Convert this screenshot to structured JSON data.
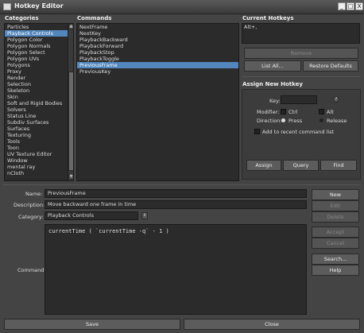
{
  "window": {
    "title": "Hotkey Editor",
    "controls": [
      "_",
      "□",
      "X"
    ]
  },
  "categories": {
    "header": "Categories",
    "items": [
      "Particles",
      "Playback Controls",
      "Polygon Color",
      "Polygon Normals",
      "Polygon Select",
      "Polygon UVs",
      "Polygons",
      "Proxy",
      "Render",
      "Selection",
      "Skeleton",
      "Skin",
      "Soft and Rigid Bodies",
      "Solvers",
      "Status Line",
      "Subdiv Surfaces",
      "Surfaces",
      "Texturing",
      "Tools",
      "Toon",
      "UV Texture Editor",
      "Window",
      "mental ray",
      "nCloth"
    ],
    "selected_index": 1
  },
  "commands": {
    "header": "Commands",
    "items": [
      "NextFrame",
      "NextKey",
      "PlaybackBackward",
      "PlaybackForward",
      "PlaybackStop",
      "PlaybackToggle",
      "PreviousFrame",
      "PreviousKey"
    ],
    "selected_index": 6
  },
  "current_hotkeys": {
    "header": "Current Hotkeys",
    "value": "Alt+,",
    "remove_label": "Remove",
    "list_all_label": "List All...",
    "restore_label": "Restore Defaults"
  },
  "assign": {
    "header": "Assign New Hotkey",
    "key_label": "Key:",
    "key_value": "",
    "help_glyph": "?",
    "modifier_label": "Modifier:",
    "ctrl_label": "Ctrl",
    "alt_label": "Alt",
    "direction_label": "Direction:",
    "press_label": "Press",
    "release_label": "Release",
    "recent_label": "Add to recent command list",
    "assign_btn": "Assign",
    "query_btn": "Query",
    "find_btn": "Find"
  },
  "editor": {
    "name_label": "Name:",
    "name_value": "PreviousFrame",
    "description_label": "Description:",
    "description_value": "Move backward one frame in time",
    "category_label": "Category:",
    "category_value": "Playback Controls",
    "command_label": "Command:",
    "command_value": "currentTime ( `currentTime -q` - 1 )"
  },
  "side_buttons": {
    "new": "New",
    "edit": "Edit",
    "delete": "Delete",
    "accept": "Accept",
    "cancel": "Cancel",
    "search": "Search...",
    "help": "Help"
  },
  "footer": {
    "save": "Save",
    "close": "Close"
  }
}
